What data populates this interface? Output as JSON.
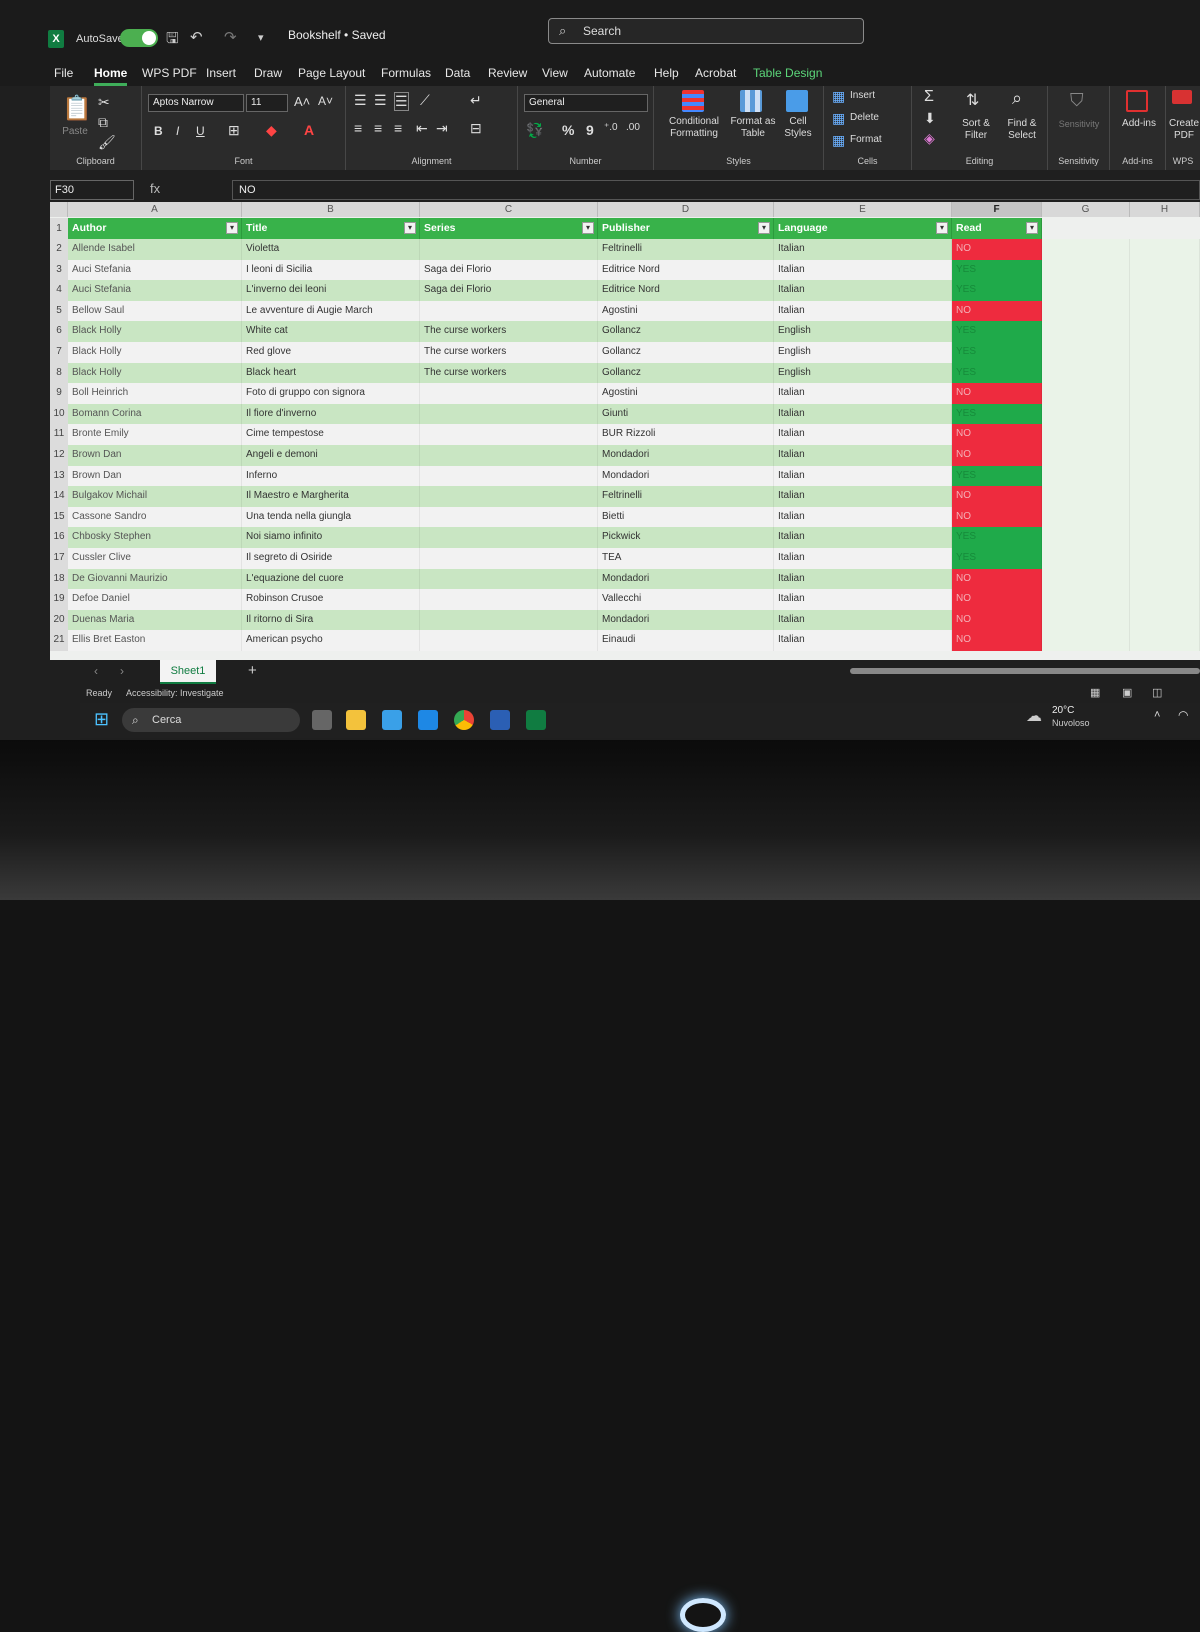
{
  "titlebar": {
    "autosave_label": "AutoSave",
    "doc_title": "Bookshelf • Saved",
    "search_placeholder": "Search"
  },
  "menu_tabs": [
    "File",
    "Home",
    "WPS PDF",
    "Insert",
    "Draw",
    "Page Layout",
    "Formulas",
    "Data",
    "Review",
    "View",
    "Automate",
    "Help",
    "Acrobat",
    "Table Design"
  ],
  "ribbon": {
    "clipboard": {
      "label": "Clipboard",
      "paste": "Paste"
    },
    "font": {
      "label": "Font",
      "font_name": "Aptos Narrow",
      "font_size": "11"
    },
    "alignment": {
      "label": "Alignment"
    },
    "number": {
      "label": "Number",
      "format": "General"
    },
    "styles": {
      "label": "Styles",
      "conditional": "Conditional Formatting",
      "format_table": "Format as Table",
      "cell_styles": "Cell Styles"
    },
    "cells": {
      "label": "Cells",
      "insert": "Insert",
      "delete": "Delete",
      "format": "Format"
    },
    "editing": {
      "label": "Editing",
      "sort": "Sort & Filter",
      "find": "Find & Select"
    },
    "sensitivity": {
      "label": "Sensitivity",
      "button": "Sensitivity"
    },
    "addins": {
      "label": "Add-ins",
      "button": "Add-ins"
    },
    "wps": {
      "label": "WPS",
      "button": "Create PDF"
    }
  },
  "formula_bar": {
    "name_box": "F30",
    "fx": "fx",
    "value": "NO"
  },
  "columns": [
    "A",
    "B",
    "C",
    "D",
    "E",
    "F",
    "G",
    "H"
  ],
  "table": {
    "headers": [
      "Author",
      "Title",
      "Series",
      "Publisher",
      "Language",
      "Read"
    ],
    "rows": [
      [
        "Allende Isabel",
        "Violetta",
        "",
        "Feltrinelli",
        "Italian",
        "NO"
      ],
      [
        "Auci Stefania",
        "I leoni di Sicilia",
        "Saga dei Florio",
        "Editrice Nord",
        "Italian",
        "YES"
      ],
      [
        "Auci Stefania",
        "L'inverno dei leoni",
        "Saga dei Florio",
        "Editrice Nord",
        "Italian",
        "YES"
      ],
      [
        "Bellow Saul",
        "Le avventure di Augie March",
        "",
        "Agostini",
        "Italian",
        "NO"
      ],
      [
        "Black Holly",
        "White cat",
        "The curse workers",
        "Gollancz",
        "English",
        "YES"
      ],
      [
        "Black Holly",
        "Red glove",
        "The curse workers",
        "Gollancz",
        "English",
        "YES"
      ],
      [
        "Black Holly",
        "Black heart",
        "The curse workers",
        "Gollancz",
        "English",
        "YES"
      ],
      [
        "Boll Heinrich",
        "Foto di gruppo con signora",
        "",
        "Agostini",
        "Italian",
        "NO"
      ],
      [
        "Bomann Corina",
        "Il fiore d'inverno",
        "",
        "Giunti",
        "Italian",
        "YES"
      ],
      [
        "Bronte Emily",
        "Cime tempestose",
        "",
        "BUR Rizzoli",
        "Italian",
        "NO"
      ],
      [
        "Brown Dan",
        "Angeli e demoni",
        "",
        "Mondadori",
        "Italian",
        "NO"
      ],
      [
        "Brown Dan",
        "Inferno",
        "",
        "Mondadori",
        "Italian",
        "YES"
      ],
      [
        "Bulgakov Michail",
        "Il Maestro e Margherita",
        "",
        "Feltrinelli",
        "Italian",
        "NO"
      ],
      [
        "Cassone Sandro",
        "Una tenda nella giungla",
        "",
        "Bietti",
        "Italian",
        "NO"
      ],
      [
        "Chbosky Stephen",
        "Noi siamo infinito",
        "",
        "Pickwick",
        "Italian",
        "YES"
      ],
      [
        "Cussler Clive",
        "Il segreto di Osiride",
        "",
        "TEA",
        "Italian",
        "YES"
      ],
      [
        "De Giovanni Maurizio",
        "L'equazione del cuore",
        "",
        "Mondadori",
        "Italian",
        "NO"
      ],
      [
        "Defoe Daniel",
        "Robinson Crusoe",
        "",
        "Vallecchi",
        "Italian",
        "NO"
      ],
      [
        "Duenas Maria",
        "Il ritorno di Sira",
        "",
        "Mondadori",
        "Italian",
        "NO"
      ],
      [
        "Ellis Bret Easton",
        "American psycho",
        "",
        "Einaudi",
        "Italian",
        "NO"
      ]
    ]
  },
  "sheet_tab": "Sheet1",
  "status": {
    "ready": "Ready",
    "accessibility": "Accessibility: Investigate"
  },
  "taskbar": {
    "search": "Cerca",
    "temp": "20°C",
    "weather": "Nuvoloso"
  },
  "colors": {
    "header_green": "#38b24a",
    "yes": "#1faa4a",
    "no": "#ee2b3e",
    "band": "#c9e6c3",
    "accent": "#107c41"
  }
}
